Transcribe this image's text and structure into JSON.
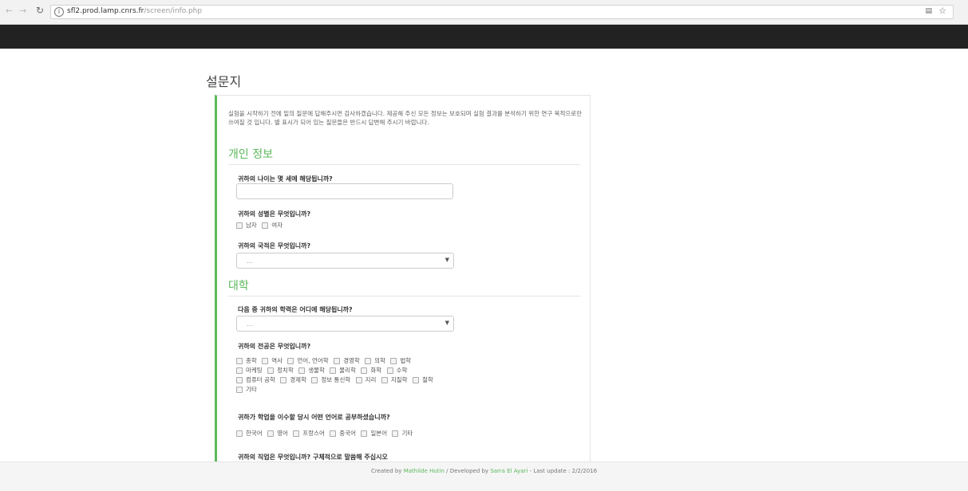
{
  "browser": {
    "url_host": "sfl2.prod.lamp.cnrs.fr",
    "url_path": "/screen/info.php"
  },
  "page": {
    "title": "설문지",
    "intro": "실험을 시작하기 전에 밑의 질문에 답해주시면 감사하겠습니다. 제공해 주신 모든 정보는 보호되며 실험 결과를 분석하기 위한 연구 목적으로만 쓰여질 것 입니다. 별 표시가 되어 있는 질문들은 반드시 답변해 주시기 바랍니다."
  },
  "sections": {
    "personal": {
      "heading": "개인 정보",
      "age_question": "귀하의 나이는 몇 세에 해당됩니까?",
      "gender_question": "귀하의 성별은 무엇입니까?",
      "gender_options": [
        "남자",
        "여자"
      ],
      "nationality_question": "귀하의 국적은 무엇입니까?",
      "nationality_selected": "..."
    },
    "university": {
      "heading": "대학",
      "degree_question": "다음 중 귀하의 학력은 어디에 해당됩니까?",
      "degree_selected": "...",
      "major_question": "귀하의 전공은 무엇입니까?",
      "major_options": [
        [
          "종학",
          "역사",
          "언어, 언어학",
          "경영학",
          "의학",
          "법학"
        ],
        [
          "마케팅",
          "정치학",
          "생물학",
          "물리학",
          "화학",
          "수학"
        ],
        [
          "컴퓨터 공학",
          "경제학",
          "정보 통신학",
          "지리",
          "지질학",
          "철학"
        ],
        [
          "기타"
        ]
      ],
      "language_question": "귀하가 학업을 이수할 당시 어떤 언어로 공부하셨습니까?",
      "language_options": [
        "한국어",
        "영어",
        "프랑스어",
        "중국어",
        "일본어",
        "기타"
      ],
      "job_question": "귀하의 직업은 무엇입니까? 구체적으로 말씀해 주십시오"
    }
  },
  "footer": {
    "created_prefix": "Created by ",
    "created_name": "Mathilde Hutin",
    "dev_prefix": " / Developed by ",
    "dev_name": "Sarra El Ayari",
    "last_update": " - Last update : 2/2/2016"
  }
}
